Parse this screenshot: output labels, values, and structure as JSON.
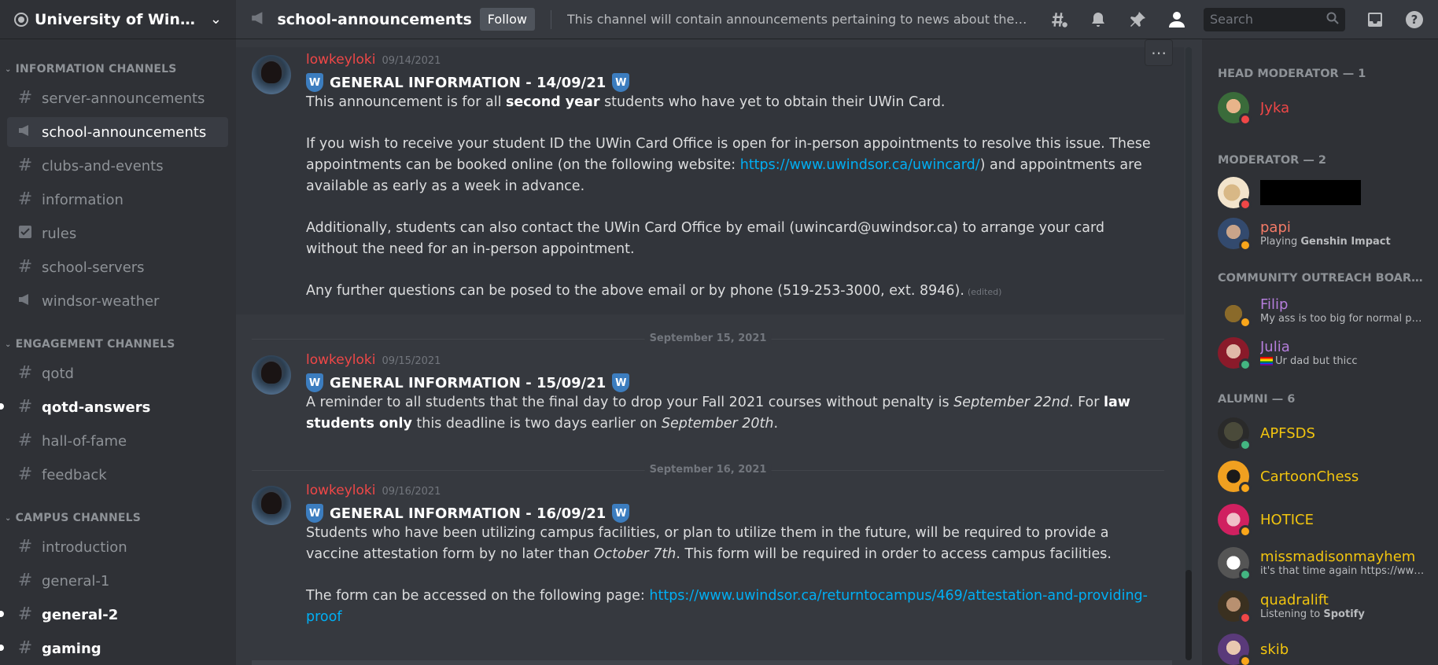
{
  "server": {
    "name": "University of Windsor..."
  },
  "categories": {
    "info": "INFORMATION CHANNELS",
    "engagement": "ENGAGEMENT CHANNELS",
    "campus": "CAMPUS CHANNELS"
  },
  "channels": [
    {
      "name": "server-announcements",
      "icon": "hash-icon"
    },
    {
      "name": "school-announcements",
      "icon": "megaphone-icon",
      "active": true
    },
    {
      "name": "clubs-and-events",
      "icon": "hash-icon"
    },
    {
      "name": "information",
      "icon": "hash-icon"
    },
    {
      "name": "rules",
      "icon": "checkbox-icon"
    },
    {
      "name": "school-servers",
      "icon": "hash-icon"
    },
    {
      "name": "windsor-weather",
      "icon": "megaphone-icon"
    },
    {
      "name": "qotd",
      "icon": "locked-hash-icon"
    },
    {
      "name": "qotd-answers",
      "icon": "locked-hash-icon",
      "unread": true
    },
    {
      "name": "hall-of-fame",
      "icon": "locked-hash-icon"
    },
    {
      "name": "feedback",
      "icon": "locked-hash-icon"
    },
    {
      "name": "introduction",
      "icon": "hash-icon"
    },
    {
      "name": "general-1",
      "icon": "hash-icon"
    },
    {
      "name": "general-2",
      "icon": "hash-icon",
      "unread": true
    },
    {
      "name": "gaming",
      "icon": "hash-icon",
      "unread": true
    }
  ],
  "topbar": {
    "channel": "school-announcements",
    "follow": "Follow",
    "topic": "This channel will contain announcements pertaining to news about the University of Windsor and its campus facilities.",
    "search_placeholder": "Search"
  },
  "messages": [
    {
      "author": "lowkeyloki",
      "time": "09/14/2021",
      "title": "GENERAL INFORMATION - 14/09/21",
      "p1_a": "This announcement is for all ",
      "p1_b": "second year",
      "p1_c": " students who have yet to obtain their UWin Card.",
      "p2_a": "If you wish to receive your student ID the UWin Card Office is open for in-person appointments to resolve this issue. These appointments can be booked online (on the following website: ",
      "p2_link": "https://www.uwindsor.ca/uwincard/",
      "p2_b": ") and appointments are available as early as a week in advance.",
      "p3": "Additionally, students can also contact the UWin Card Office by email (uwincard@uwindsor.ca) to arrange your card without the need for an in-person appointment.",
      "p4": "Any further questions can be posed to the above email or by phone (519-253-3000, ext. 8946).",
      "edited": "(edited)"
    },
    {
      "date": "September 15, 2021",
      "author": "lowkeyloki",
      "time": "09/15/2021",
      "title": "GENERAL INFORMATION - 15/09/21",
      "p1_a": "A reminder to all students that the final day to drop your Fall 2021 courses without penalty is ",
      "p1_i": "September 22nd",
      "p1_b": ". For ",
      "p1_bold": "law students only",
      "p1_c": " this deadline is two days earlier on ",
      "p1_i2": "September 20th",
      "p1_d": "."
    },
    {
      "date": "September 16, 2021",
      "author": "lowkeyloki",
      "time": "09/16/2021",
      "title": "GENERAL INFORMATION - 16/09/21",
      "p1_a": "Students who have been utilizing campus facilities, or plan to utilize them in the future, will be required to provide a vaccine attestation form by no later than ",
      "p1_i": "October 7th",
      "p1_b": ". This form will be required in order to access campus facilities.",
      "p2_a": "The form can be accessed on the following page: ",
      "p2_link": "https://www.uwindsor.ca/returntocampus/469/attestation-and-providing-proof"
    }
  ],
  "members": {
    "groups": [
      {
        "label": "HEAD MODERATOR — 1"
      },
      {
        "label": "MODERATOR — 2"
      },
      {
        "label": "COMMUNITY OUTREACH BOARD — 2"
      },
      {
        "label": "ALUMNI — 6"
      }
    ],
    "list": [
      {
        "name": "Jyka",
        "color": "#f04747",
        "status": "dnd"
      },
      {
        "name": "",
        "color": "#ffffff",
        "status": "dnd",
        "redacted": true
      },
      {
        "name": "papi",
        "color": "#f47b67",
        "status": "idle",
        "sub_a": "Playing ",
        "sub_b": "Genshin Impact"
      },
      {
        "name": "Filip",
        "color": "#b57edc",
        "status": "idle",
        "sub_a": "My ass is too big for normal pants"
      },
      {
        "name": "Julia",
        "color": "#b57edc",
        "status": "online",
        "sub_a": "Ur dad but thicc"
      },
      {
        "name": "APFSDS",
        "color": "#f1c40f",
        "status": "online"
      },
      {
        "name": "CartoonChess",
        "color": "#f1c40f",
        "status": "idle"
      },
      {
        "name": "HOTICE",
        "color": "#f1c40f",
        "status": "idle"
      },
      {
        "name": "missmadisonmayhem",
        "color": "#f1c40f",
        "status": "online",
        "sub_a": "it's that time again https://www.youtube.com"
      },
      {
        "name": "quadralift",
        "color": "#f1c40f",
        "status": "dnd",
        "sub_a": "Listening to ",
        "sub_b": "Spotify"
      },
      {
        "name": "skib",
        "color": "#f1c40f",
        "status": "idle"
      }
    ]
  },
  "colors": {
    "accent": "#5865f2",
    "link": "#00aff4",
    "username": "#f04747"
  }
}
